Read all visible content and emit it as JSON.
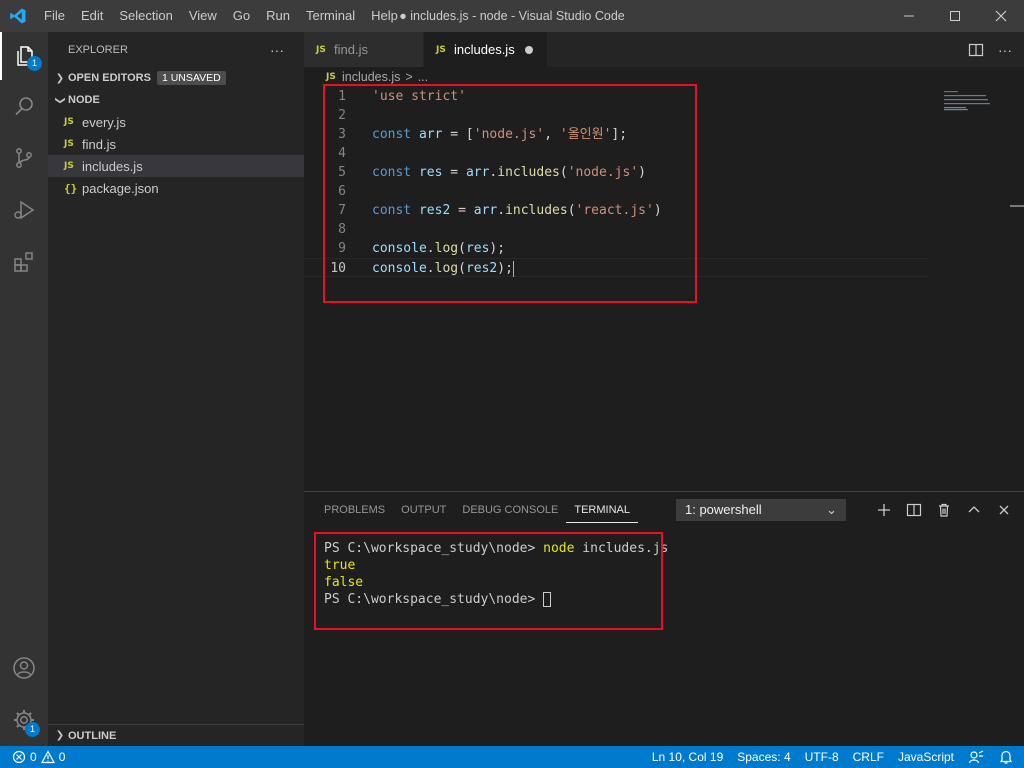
{
  "window": {
    "title": "● includes.js - node - Visual Studio Code",
    "icons": [
      "vscode-logo",
      "minimize-icon",
      "maximize-icon",
      "close-icon"
    ]
  },
  "menu": [
    "File",
    "Edit",
    "Selection",
    "View",
    "Go",
    "Run",
    "Terminal",
    "Help"
  ],
  "activity_bar": {
    "explorer_badge": "1",
    "settings_badge": "1",
    "icons": [
      "files-icon",
      "search-icon",
      "source-control-icon",
      "run-debug-icon",
      "extensions-icon",
      "account-icon",
      "settings-gear-icon"
    ]
  },
  "sidebar": {
    "title": "EXPLORER",
    "more": "···",
    "open_editors_label": "OPEN EDITORS",
    "unsaved_badge": "1 UNSAVED",
    "folder_label": "NODE",
    "files": [
      {
        "icon": "JS",
        "name": "every.js"
      },
      {
        "icon": "JS",
        "name": "find.js"
      },
      {
        "icon": "JS",
        "name": "includes.js"
      },
      {
        "icon": "{}",
        "name": "package.json"
      }
    ],
    "outline_label": "OUTLINE"
  },
  "tabs": [
    {
      "icon": "JS",
      "label": "find.js"
    },
    {
      "icon": "JS",
      "label": "includes.js"
    }
  ],
  "breadcrumb": {
    "icon": "JS",
    "file": "includes.js",
    "sep": ">",
    "rest": "..."
  },
  "editor": {
    "line_numbers": [
      "1",
      "2",
      "3",
      "4",
      "5",
      "6",
      "7",
      "8",
      "9",
      "10"
    ],
    "lines": {
      "l1_str": "'use strict'",
      "l3_kw": "const",
      "l3_var": "arr",
      "l3_eq": " = [",
      "l3_s1": "'node.js'",
      "l3_comma": ", ",
      "l3_s2": "'올인원'",
      "l3_end": "];",
      "l5_kw": "const",
      "l5_var": "res",
      "l5_eq": " = ",
      "l5_obj": "arr",
      "l5_dot": ".",
      "l5_fn": "includes",
      "l5_open": "(",
      "l5_s": "'node.js'",
      "l5_close": ")",
      "l7_kw": "const",
      "l7_var": "res2",
      "l7_eq": " = ",
      "l7_obj": "arr",
      "l7_dot": ".",
      "l7_fn": "includes",
      "l7_open": "(",
      "l7_s": "'react.js'",
      "l7_close": ")",
      "l9_obj": "console",
      "l9_dot": ".",
      "l9_fn": "log",
      "l9_open": "(",
      "l9_var": "res",
      "l9_close": ");",
      "l10_obj": "console",
      "l10_dot": ".",
      "l10_fn": "log",
      "l10_open": "(",
      "l10_var": "res2",
      "l10_close": ");"
    }
  },
  "panel": {
    "tabs": [
      "PROBLEMS",
      "OUTPUT",
      "DEBUG CONSOLE",
      "TERMINAL"
    ],
    "active_tab": "TERMINAL",
    "terminal_select": "1: powershell",
    "terminal": {
      "prompt1": "PS C:\\workspace_study\\node> ",
      "cmd_node": "node",
      "cmd_arg": " includes.js",
      "out1": "true",
      "out2": "false",
      "prompt2": "PS C:\\workspace_study\\node> "
    }
  },
  "statusbar": {
    "errors": "0",
    "warnings": "0",
    "position": "Ln 10, Col 19",
    "spaces": "Spaces: 4",
    "encoding": "UTF-8",
    "eol": "CRLF",
    "language": "JavaScript"
  },
  "colors": {
    "accent": "#007acc",
    "highlight_box": "#e81123",
    "keyword": "#569cd6",
    "string": "#ce9178",
    "variable": "#9cdcfe",
    "function": "#dcdcaa"
  }
}
